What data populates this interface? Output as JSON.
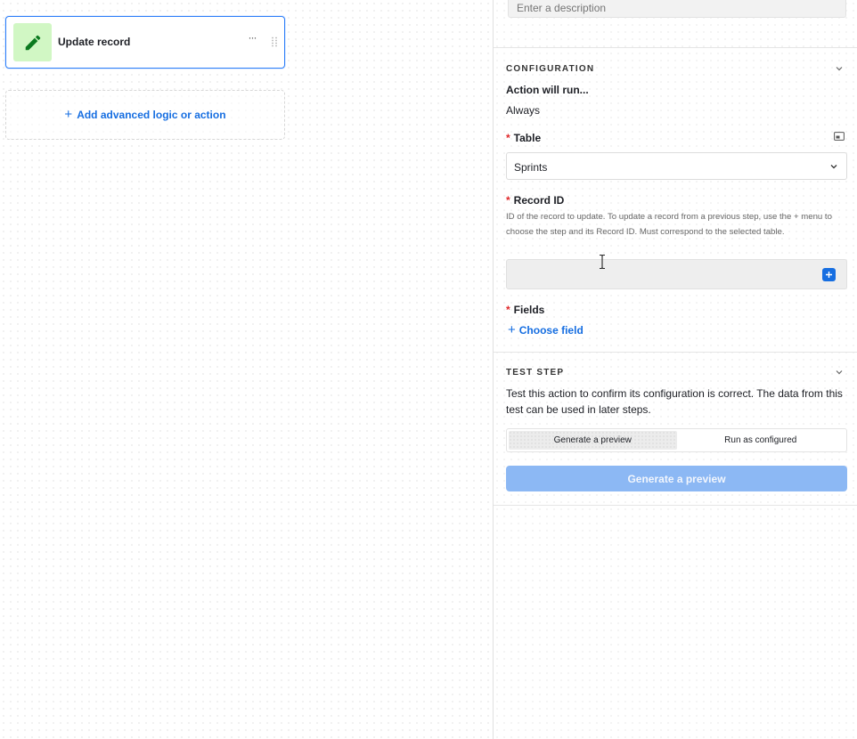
{
  "canvas": {
    "step": {
      "title": "Update record",
      "more_label": "···"
    },
    "add_logic": {
      "label": "Add advanced logic or action"
    }
  },
  "panel": {
    "description": {
      "placeholder": "Enter a description"
    },
    "configuration": {
      "header": "CONFIGURATION",
      "action_label": "Action will run...",
      "action_value": "Always",
      "table": {
        "label": "Table",
        "value": "Sprints"
      },
      "record_id": {
        "label": "Record ID",
        "help": "ID of the record to update. To update a record from a previous step, use the + menu to choose the step and its Record ID. Must correspond to the selected table.",
        "value": ""
      },
      "fields": {
        "label": "Fields",
        "choose_label": "Choose field"
      }
    },
    "test_step": {
      "header": "TEST STEP",
      "description": "Test this action to confirm its configuration is correct. The data from this test can be used in later steps.",
      "options": [
        "Generate a preview",
        "Run as configured"
      ],
      "selected_option": "Generate a preview",
      "button_label": "Generate a preview"
    }
  },
  "colors": {
    "accent": "#166ee1",
    "selection_border": "#2d7ff9",
    "icon_bg": "#d1f7c4",
    "icon_fg": "#0b7a1f",
    "required": "#e0282a",
    "disabled_button": "#8cb8f4"
  },
  "icons": {
    "step": "pencil-icon",
    "step_more": "ellipsis-icon",
    "step_drag": "drag-handle-icon",
    "add": "plus-icon",
    "section_toggle": "chevron-down-icon",
    "table_settings": "expand-icon",
    "record_insert": "plus-square-icon",
    "cursor": "text-cursor-icon"
  }
}
